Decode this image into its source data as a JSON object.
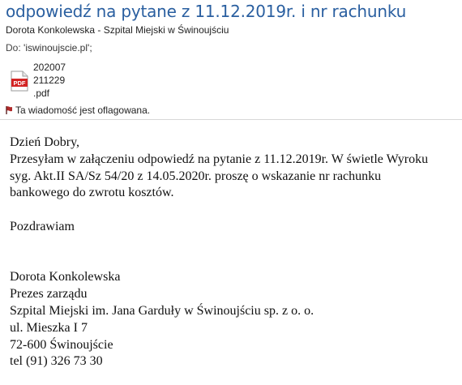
{
  "subject": "odpowiedź na pytane z 11.12.2019r. i nr rachunku",
  "sender": "Dorota Konkolewska - Szpital Miejski w Świnoujściu",
  "to": {
    "label": "Do:",
    "value": "'iswinoujscie.pl';"
  },
  "attachment": {
    "icon": "pdf-icon",
    "name_lines": [
      "202007",
      "211229",
      ".pdf"
    ]
  },
  "flag_text": "Ta wiadomość jest oflagowana.",
  "body": {
    "greeting": "Dzień Dobry,",
    "paragraph_lines": [
      "Przesyłam w załączeniu odpowiedź na pytanie z 11.12.2019r. W świetle Wyroku",
      "syg. Akt.II SA/Sz 54/20 z 14.05.2020r. proszę o wskazanie nr rachunku",
      "bankowego do zwrotu kosztów."
    ],
    "closing": "Pozdrawiam",
    "signature": [
      "Dorota Konkolewska",
      "Prezes zarządu",
      "Szpital Miejski im. Jana Garduły w Świnoujściu sp. z o. o.",
      "ul. Mieszka I 7",
      "72-600 Świnoujście",
      "tel (91) 326 73 30"
    ]
  },
  "colors": {
    "subject": "#2a5fa0",
    "pdf_red": "#d32424"
  }
}
